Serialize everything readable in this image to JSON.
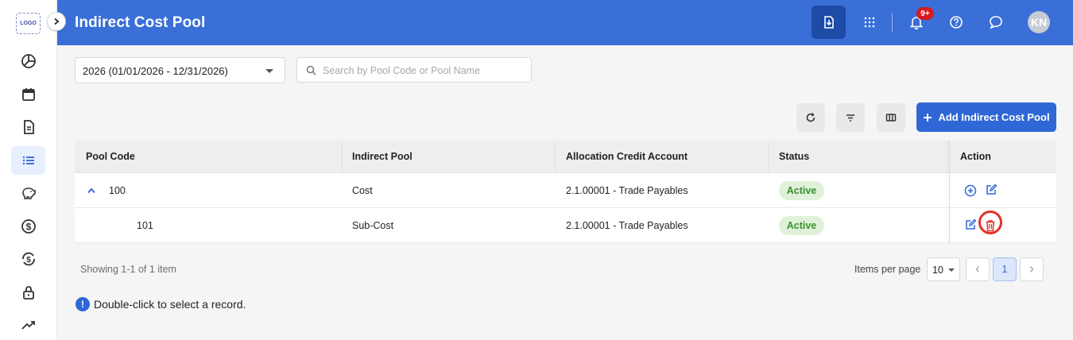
{
  "app": {
    "logo_text": "LOGO"
  },
  "header": {
    "title": "Indirect Cost Pool",
    "notification_badge": "9+",
    "avatar_initials": "KN"
  },
  "filters": {
    "year_value": "2026 (01/01/2026 - 12/31/2026)",
    "search_placeholder": "Search by Pool Code or Pool Name",
    "search_value": ""
  },
  "toolbar": {
    "add_label": "Add Indirect Cost Pool"
  },
  "table": {
    "columns": [
      "Pool Code",
      "Indirect Pool",
      "Allocation Credit Account",
      "Status",
      "Action"
    ],
    "rows": [
      {
        "code": "100",
        "pool": "Cost",
        "account": "2.1.00001 - Trade Payables",
        "status": "Active",
        "expanded": true
      },
      {
        "code": "101",
        "pool": "Sub-Cost",
        "account": "2.1.00001 - Trade Payables",
        "status": "Active"
      }
    ]
  },
  "footer": {
    "showing": "Showing 1-1 of 1 item",
    "items_per_page_label": "Items per page",
    "items_per_page_value": "10",
    "current_page": "1"
  },
  "hint": {
    "text": "Double-click to select a record.",
    "icon_glyph": "!"
  },
  "colors": {
    "header": "#3a6fd8",
    "accent": "#2f67d6",
    "status_active_bg": "#dff2d9",
    "status_active_text": "#3c8f2e",
    "highlight_ring": "#e53126"
  }
}
